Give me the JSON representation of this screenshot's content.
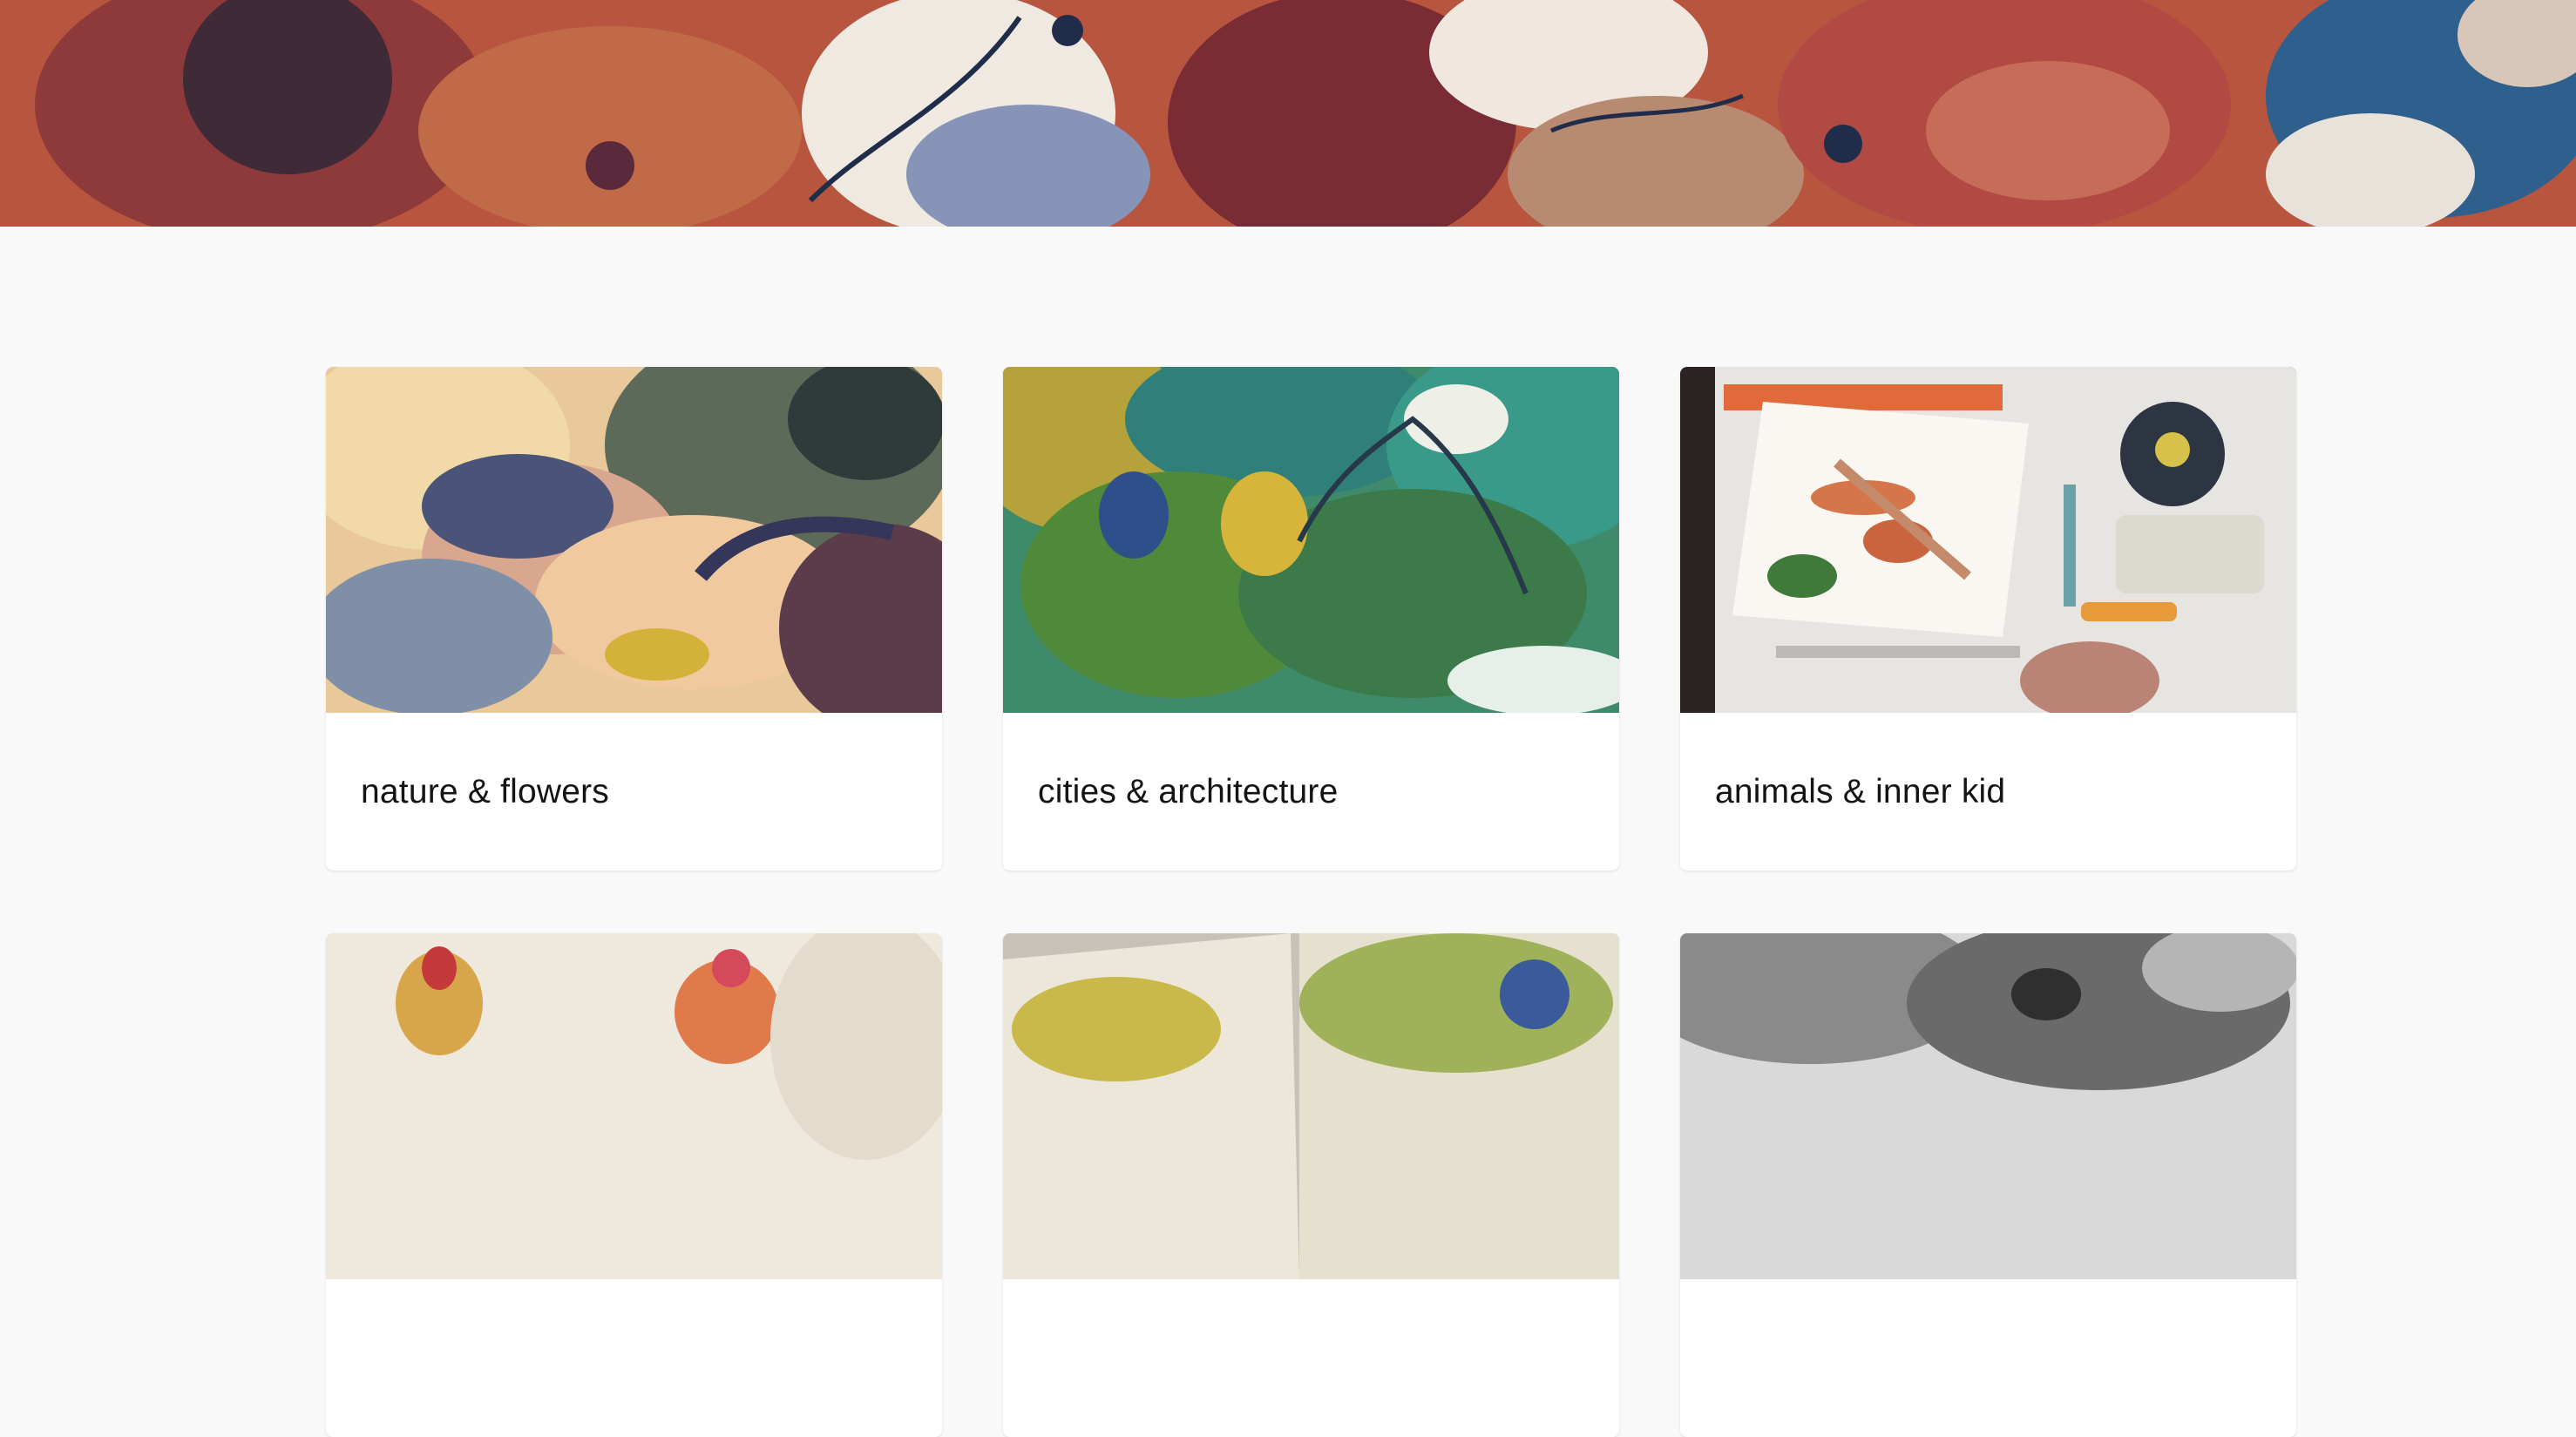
{
  "hero": {
    "image": "watercolor-banner",
    "colors": [
      "#b24a3e",
      "#4a2a34",
      "#f1ede6",
      "#2e5d8a",
      "#c77a52"
    ]
  },
  "categories": [
    {
      "title": "nature & flowers",
      "image": "watercolor-flower"
    },
    {
      "title": "cities & architecture",
      "image": "watercolor-city"
    },
    {
      "title": "animals & inner kid",
      "image": "fox-painting-desk"
    },
    {
      "title": "",
      "image": "watercolor-roosters"
    },
    {
      "title": "",
      "image": "sketchbook-pages"
    },
    {
      "title": "",
      "image": "charcoal-texture"
    }
  ]
}
